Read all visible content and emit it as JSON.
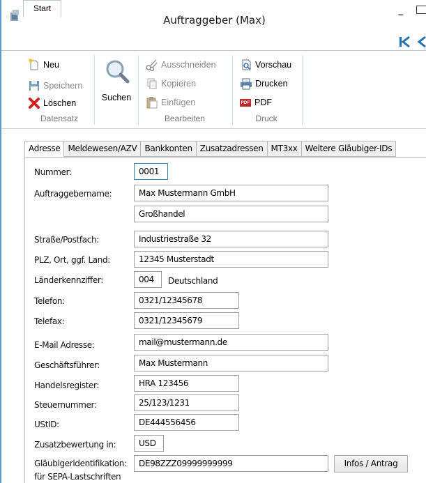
{
  "window": {
    "title": "Auftraggeber (Max)",
    "minimize_glyph": "–"
  },
  "ribbon": {
    "tab": "Start",
    "groups": {
      "datensatz": {
        "label": "Datensatz",
        "new": "Neu",
        "save": "Speichern",
        "delete": "Löschen"
      },
      "suchen": {
        "label": "Suchen"
      },
      "bearbeiten": {
        "label": "Bearbeiten",
        "cut": "Ausschneiden",
        "copy": "Kopieren",
        "paste": "Einfügen"
      },
      "druck": {
        "label": "Druck",
        "preview": "Vorschau",
        "print": "Drucken",
        "pdf": "PDF",
        "pdf_badge": "PDF"
      }
    },
    "nav": {
      "first_icon": "first-record-icon",
      "prev_icon": "previous-record-icon"
    }
  },
  "tabs": [
    {
      "label": "Adresse",
      "active": true
    },
    {
      "label": "Meldewesen/AZV",
      "active": false
    },
    {
      "label": "Bankkonten",
      "active": false
    },
    {
      "label": "Zusatzadressen",
      "active": false
    },
    {
      "label": "MT3xx",
      "active": false
    },
    {
      "label": "Weitere Gläubiger-IDs",
      "active": false
    }
  ],
  "form": {
    "nummer": {
      "label": "Nummer:",
      "value": "0001"
    },
    "name": {
      "label": "Auftraggebername:",
      "value1": "Max Mustermann GmbH",
      "value2": "Großhandel"
    },
    "strasse": {
      "label": "Straße/Postfach:",
      "value": "Industriestraße 32"
    },
    "plz": {
      "label": "PLZ, Ort, ggf. Land:",
      "value": "12345 Musterstadt"
    },
    "land": {
      "label": "Länderkennziffer:",
      "code": "004",
      "name": "Deutschland"
    },
    "telefon": {
      "label": "Telefon:",
      "value": "0321/12345678"
    },
    "telefax": {
      "label": "Telefax:",
      "value": "0321/12345679"
    },
    "email": {
      "label": "E-Mail Adresse:",
      "value": "mail@mustermann.de"
    },
    "gf": {
      "label": "Geschäftsführer:",
      "value": "Max Mustermann"
    },
    "hr": {
      "label": "Handelsregister:",
      "value": "HRA 123456"
    },
    "steuer": {
      "label": "Steuernummer:",
      "value": "25/123/1231"
    },
    "ustid": {
      "label": "UStID:",
      "value": "DE444556456"
    },
    "zusatz": {
      "label": "Zusatzbewertung in:",
      "value": "USD"
    },
    "glaeubiger": {
      "label1": "Gläubigeridentifikation:",
      "label2": "für SEPA-Lastschriften",
      "value": "DE98ZZZ09999999999",
      "button": "Infos / Antrag"
    }
  },
  "colors": {
    "accent": "#5b9bd5",
    "focus_border": "#3c7fb1",
    "disabled_text": "#8a8a8a"
  }
}
